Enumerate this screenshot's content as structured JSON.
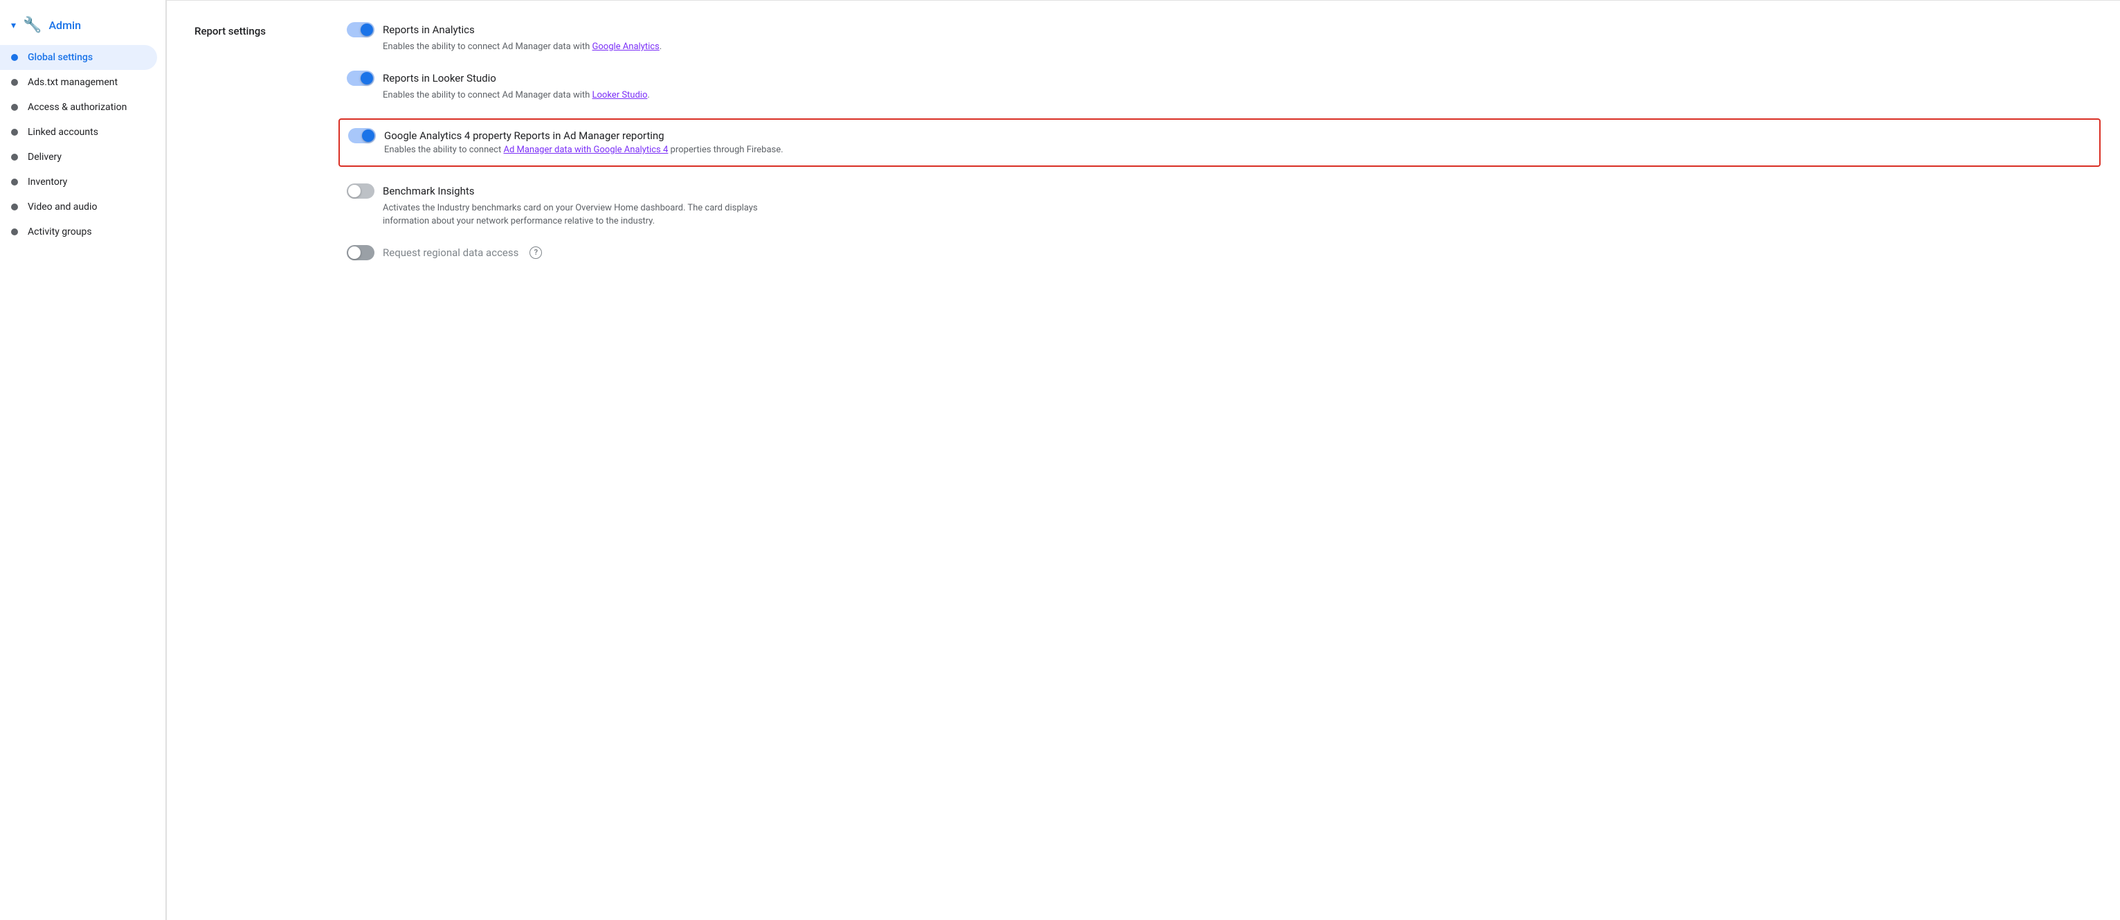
{
  "sidebar": {
    "header": {
      "label": "Admin",
      "chevron": "▾",
      "icon": "🔧"
    },
    "items": [
      {
        "id": "global-settings",
        "label": "Global settings",
        "active": true
      },
      {
        "id": "ads-txt",
        "label": "Ads.txt management",
        "active": false
      },
      {
        "id": "access-authorization",
        "label": "Access & authorization",
        "active": false
      },
      {
        "id": "linked-accounts",
        "label": "Linked accounts",
        "active": false
      },
      {
        "id": "delivery",
        "label": "Delivery",
        "active": false
      },
      {
        "id": "inventory",
        "label": "Inventory",
        "active": false
      },
      {
        "id": "video-audio",
        "label": "Video and audio",
        "active": false
      },
      {
        "id": "activity-groups",
        "label": "Activity groups",
        "active": false
      }
    ]
  },
  "main": {
    "section_title": "Report settings",
    "settings": [
      {
        "id": "reports-analytics",
        "title": "Reports in Analytics",
        "desc_text": "Enables the ability to connect Ad Manager data with ",
        "link_text": "Google Analytics",
        "desc_after": ".",
        "toggle_state": "on"
      },
      {
        "id": "reports-looker",
        "title": "Reports in Looker Studio",
        "desc_text": "Enables the ability to connect Ad Manager data with ",
        "link_text": "Looker Studio",
        "desc_after": ".",
        "toggle_state": "on"
      },
      {
        "id": "ga4-reports",
        "title": "Google Analytics 4 property Reports in Ad Manager reporting",
        "desc_before": "Enables the ability to connect ",
        "link_text": "Ad Manager data with Google Analytics 4",
        "desc_after": " properties through Firebase.",
        "toggle_state": "on",
        "highlighted": true
      },
      {
        "id": "benchmark-insights",
        "title": "Benchmark Insights",
        "desc_text": "Activates the Industry benchmarks card on your Overview Home dashboard. The card displays information about your network performance relative to the industry.",
        "toggle_state": "off"
      },
      {
        "id": "regional-data-access",
        "title": "Request regional data access",
        "toggle_state": "off-dark",
        "has_help": true
      }
    ]
  }
}
